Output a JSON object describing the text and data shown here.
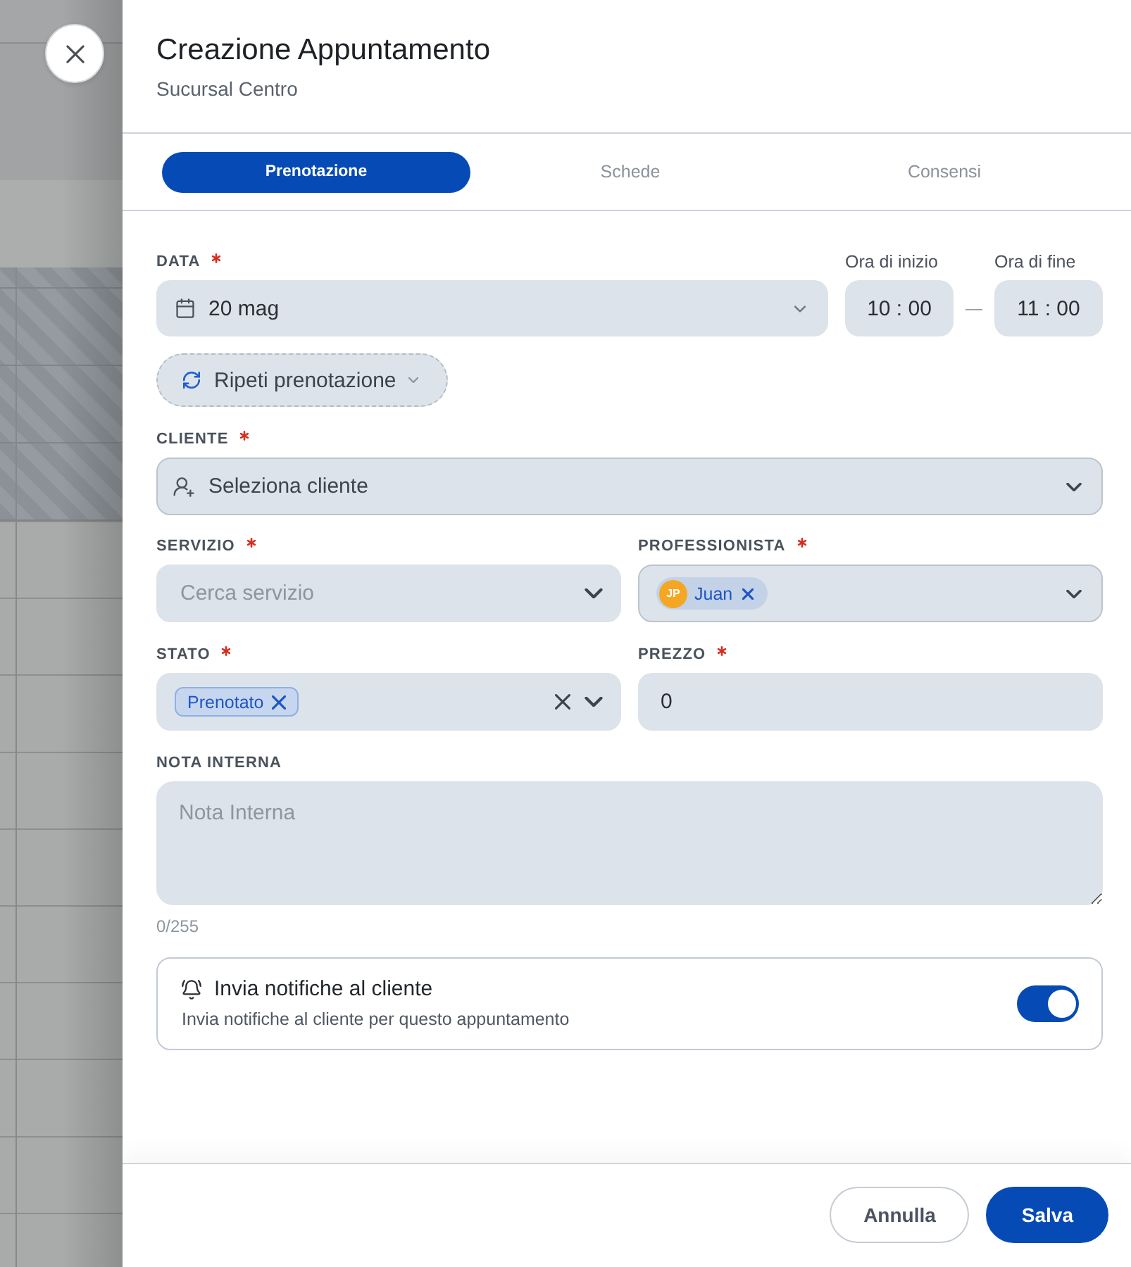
{
  "header": {
    "title": "Creazione Appuntamento",
    "subtitle": "Sucursal Centro"
  },
  "tabs": [
    {
      "label": "Prenotazione",
      "selected": true
    },
    {
      "label": "Schede",
      "selected": false
    },
    {
      "label": "Consensi",
      "selected": false
    }
  ],
  "date": {
    "label": "DATA",
    "required": true,
    "value": "20 mag"
  },
  "time": {
    "start": {
      "label": "Ora di inizio",
      "value": "10 : 00"
    },
    "separator": "—",
    "end": {
      "label": "Ora di fine",
      "value": "11 : 00"
    }
  },
  "repeat_button": {
    "label": "Ripeti prenotazione"
  },
  "client": {
    "label": "CLIENTE",
    "required": true,
    "placeholder": "Seleziona cliente"
  },
  "service": {
    "label": "SERVIZIO",
    "required": true,
    "placeholder": "Cerca servizio"
  },
  "professional": {
    "label": "PROFESSIONISTA",
    "required": true,
    "chips": [
      {
        "initials": "JP",
        "name": "Juan"
      }
    ]
  },
  "status": {
    "label": "STATO",
    "required": true,
    "chips": [
      {
        "label": "Prenotato"
      }
    ]
  },
  "price": {
    "label": "PREZZO",
    "required": true,
    "value": "0"
  },
  "note": {
    "label": "NOTA INTERNA",
    "placeholder": "Nota Interna",
    "counter": "0/255"
  },
  "notifications": {
    "title": "Invia notifiche al cliente",
    "description": "Invia notifiche al cliente per questo appuntamento",
    "on": true
  },
  "footer": {
    "buttons": [
      {
        "label": "Annulla",
        "kind": "secondary"
      },
      {
        "label": "Salva",
        "kind": "primary"
      }
    ]
  }
}
